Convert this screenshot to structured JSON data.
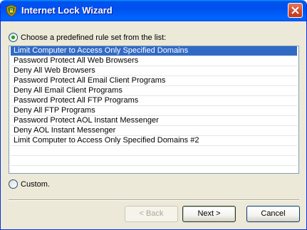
{
  "window": {
    "title": "Internet Lock Wizard",
    "icon": "shield-lock-icon"
  },
  "options": {
    "predefined_label": "Choose a predefined rule set from the list:",
    "predefined_checked": true,
    "custom_label": "Custom.",
    "custom_checked": false
  },
  "rule_list": {
    "selected_index": 0,
    "items": [
      "Limit Computer to Access Only Specified Domains",
      "Password Protect All Web Browsers",
      "Deny All Web Browsers",
      "Password Protect All Email Client Programs",
      "Deny All Email Client Programs",
      "Password Protect All FTP Programs",
      "Deny All FTP Programs",
      "Password Protect AOL Instant Messenger",
      "Deny AOL Instant Messenger",
      "Limit Computer to Access Only Specified Domains #2"
    ]
  },
  "buttons": {
    "back": "< Back",
    "back_enabled": false,
    "next": "Next >",
    "cancel": "Cancel"
  },
  "colors": {
    "titlebar": "#0053ee",
    "selection": "#316ac5",
    "dialog_bg": "#ece9d8"
  }
}
